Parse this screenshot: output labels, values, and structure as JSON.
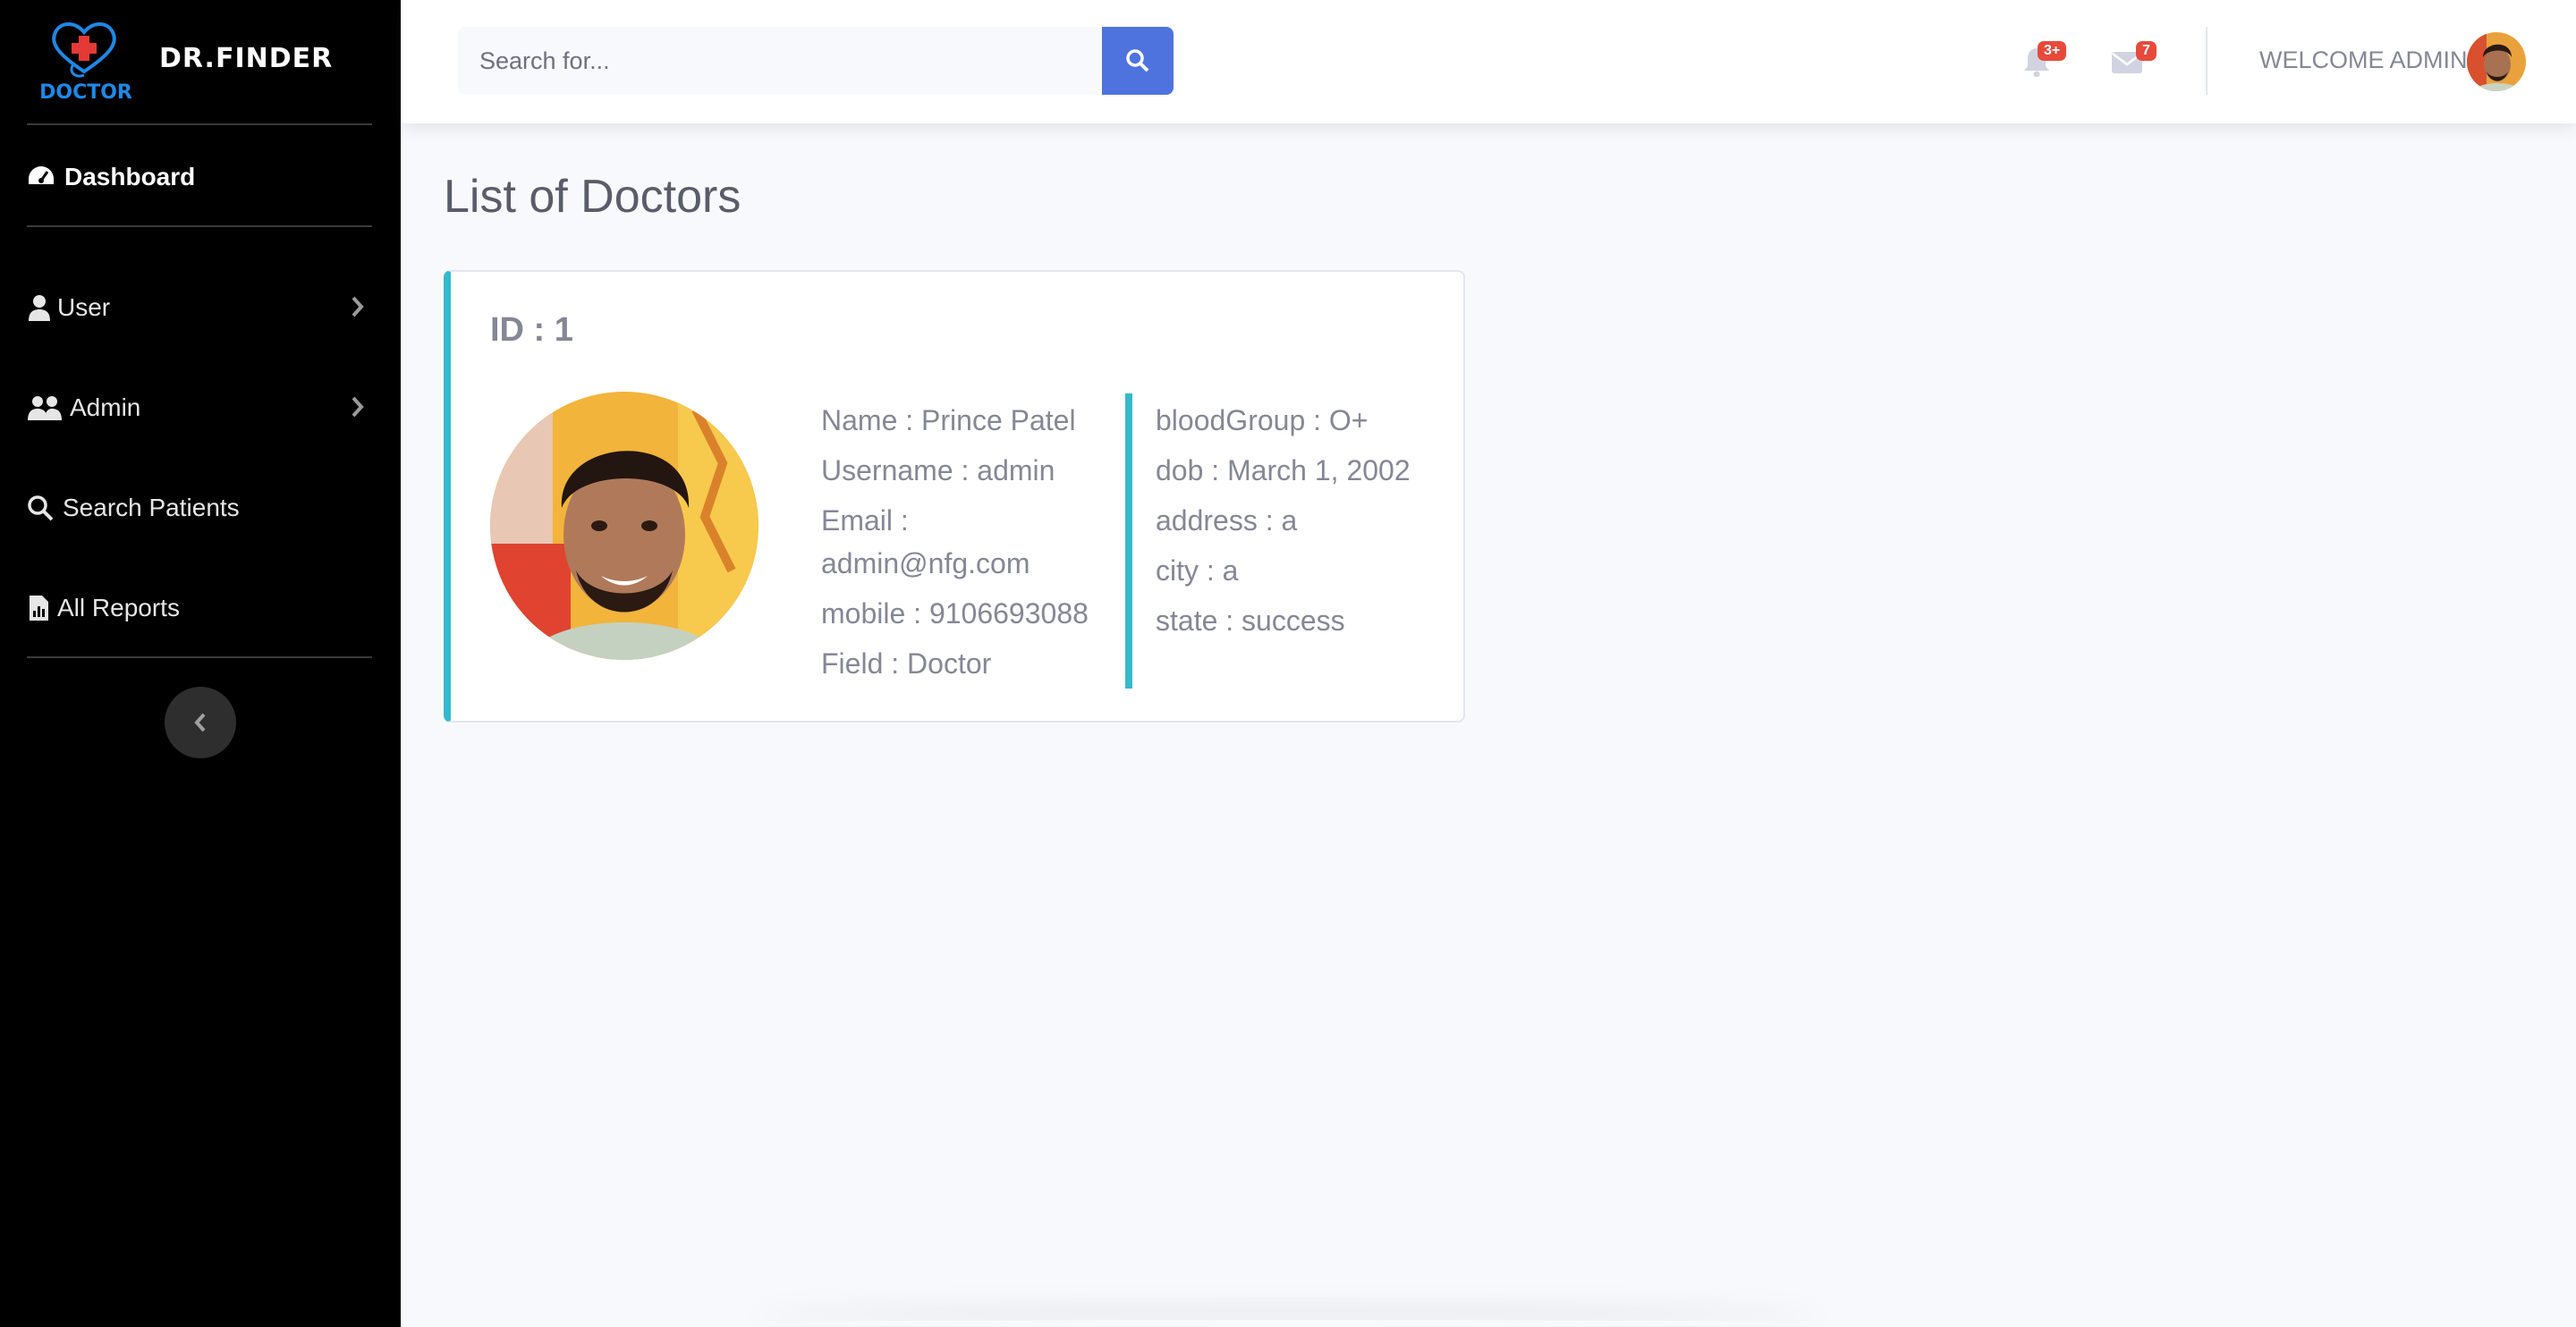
{
  "brand": {
    "logo_text": "DOCTOR",
    "name": "DR.FINDER",
    "icon": "heart-stethoscope-icon"
  },
  "sidebar": {
    "items": [
      {
        "label": "Dashboard",
        "icon": "tachometer-icon",
        "active": true,
        "has_submenu": false
      },
      {
        "label": "User",
        "icon": "user-icon",
        "active": false,
        "has_submenu": true
      },
      {
        "label": "Admin",
        "icon": "users-icon",
        "active": false,
        "has_submenu": true
      },
      {
        "label": "Search Patients",
        "icon": "search-icon",
        "active": false,
        "has_submenu": false
      },
      {
        "label": "All Reports",
        "icon": "file-chart-icon",
        "active": false,
        "has_submenu": false
      }
    ],
    "toggle_icon": "chevron-left-icon"
  },
  "topbar": {
    "search": {
      "placeholder": "Search for...",
      "value": ""
    },
    "alerts": {
      "badge": "3+",
      "icon": "bell-icon"
    },
    "messages": {
      "badge": "7",
      "icon": "envelope-icon"
    },
    "welcome": "WELCOME ADMIN"
  },
  "main": {
    "title": "List of Doctors",
    "doctors": [
      {
        "id_label": "ID : 1",
        "left": {
          "name": "Name : Prince Patel",
          "username": "Username : admin",
          "email_label": "Email :",
          "email_value": "admin@nfg.com",
          "mobile": "mobile : 9106693088",
          "field": "Field : Doctor"
        },
        "right": {
          "blood_group": "bloodGroup : O+",
          "dob": "dob : March 1, 2002",
          "address": "address : a",
          "city": "city : a",
          "state": "state : success"
        }
      }
    ]
  },
  "colors": {
    "sidebar_bg": "#000000",
    "primary": "#4e73df",
    "info": "#36b9cc",
    "danger": "#e74a3b",
    "page_bg": "#f8f9fc",
    "logo_blue": "#1e88e5",
    "logo_red": "#e53935"
  }
}
